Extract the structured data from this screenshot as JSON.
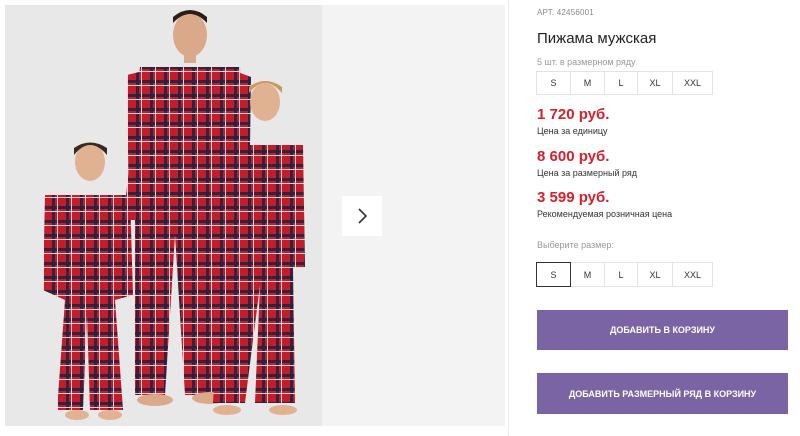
{
  "product": {
    "article": "АРТ. 42456001",
    "title": "Пижама мужская",
    "pack_label": "5 шт. в размерном ряду",
    "pack_sizes": [
      "S",
      "M",
      "L",
      "XL",
      "XXL"
    ]
  },
  "prices": [
    {
      "value": "1 720 руб.",
      "caption": "Цена за единицу"
    },
    {
      "value": "8 600 руб.",
      "caption": "Цена за размерный ряд"
    },
    {
      "value": "3 599 руб.",
      "caption": "Рекомендуемая розничная цена"
    }
  ],
  "size_select": {
    "label": "Выберите размер:",
    "options": [
      "S",
      "M",
      "L",
      "XL",
      "XXL"
    ],
    "selected": "S"
  },
  "actions": {
    "add_to_cart": "ДОБАВИТЬ В КОРЗИНУ",
    "add_pack_to_cart": "ДОБАВИТЬ РАЗМЕРНЫЙ РЯД В КОРЗИНУ"
  },
  "icons": {
    "next": "chevron-right-icon"
  },
  "colors": {
    "price": "#d6202c",
    "button": "#7a64a4",
    "plaid_red": "#c21d2b",
    "plaid_navy": "#1d2340"
  }
}
